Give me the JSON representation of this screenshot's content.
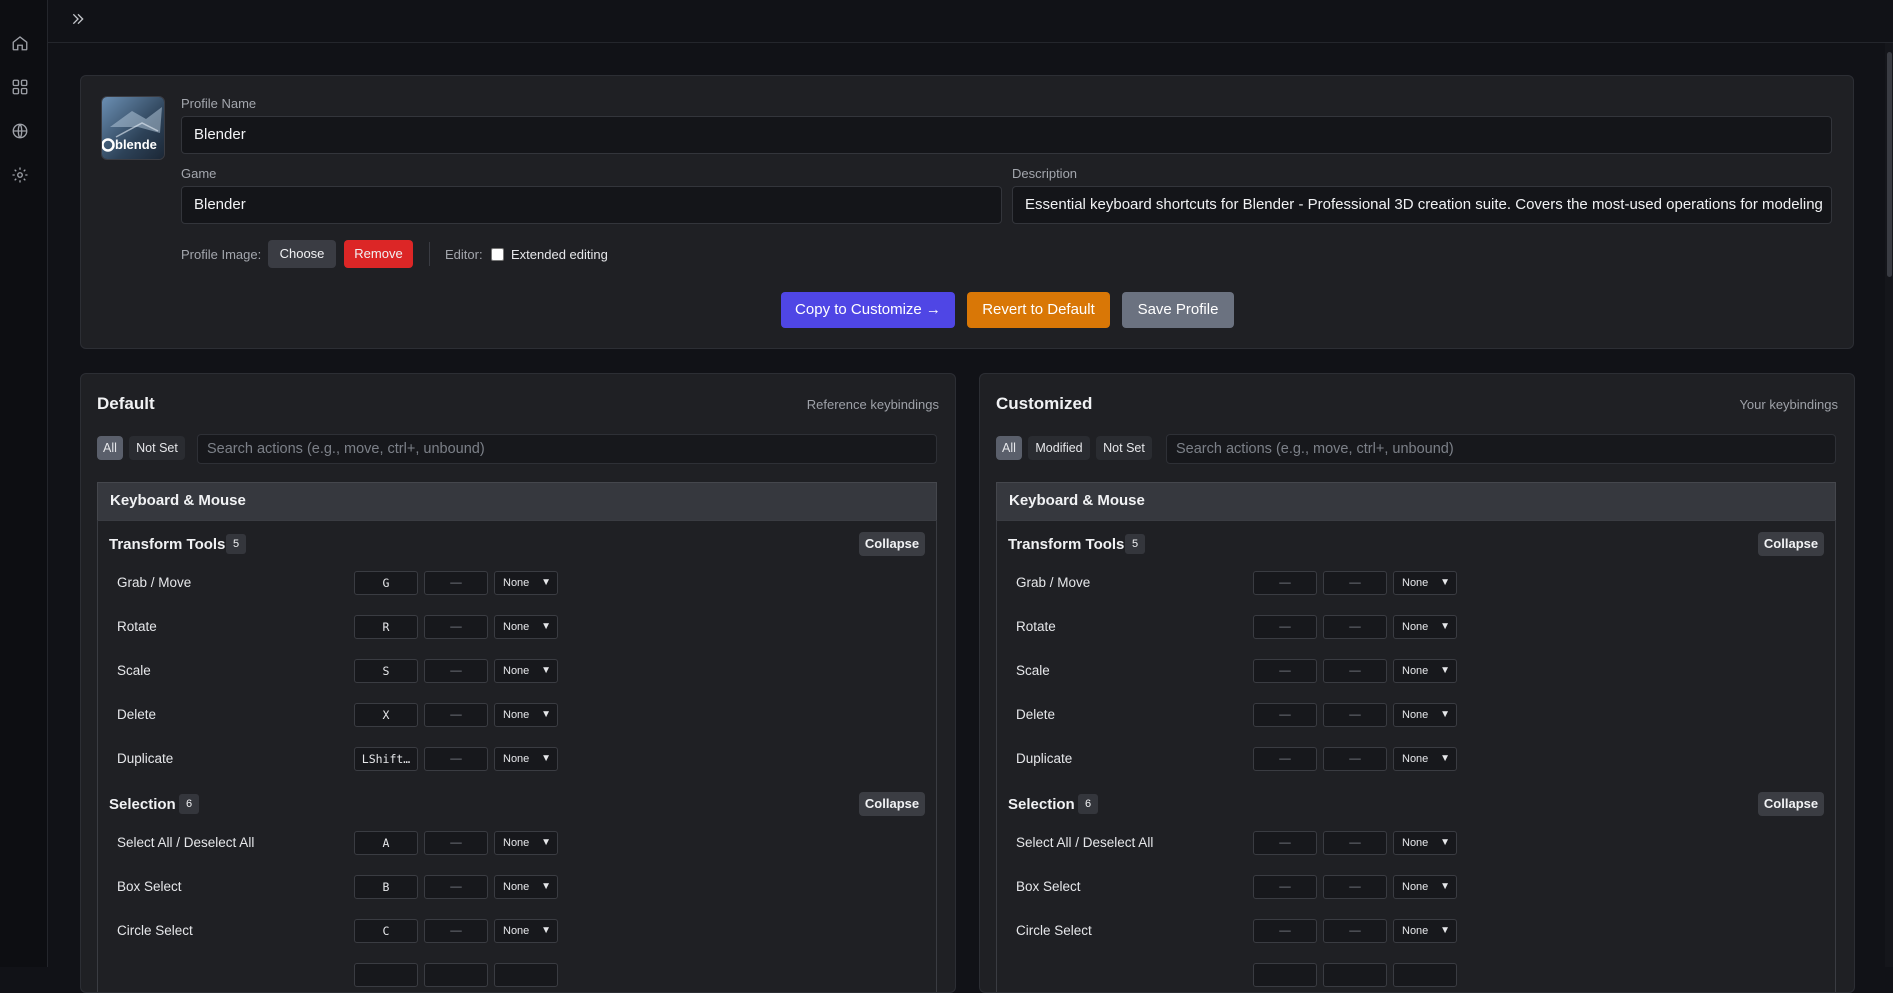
{
  "rail": {
    "icons": [
      "home-icon",
      "apps-icon",
      "globe-icon",
      "gear-icon"
    ]
  },
  "topbar": {
    "expand_icon": "double-chevron-right-icon"
  },
  "profile": {
    "name_label": "Profile Name",
    "name_value": "Blender",
    "game_label": "Game",
    "game_value": "Blender",
    "desc_label": "Description",
    "desc_value": "Essential keyboard shortcuts for Blender - Professional 3D creation suite. Covers the most-used operations for modeling",
    "image_label": "Profile Image:",
    "choose_label": "Choose",
    "remove_label": "Remove",
    "editor_label": "Editor:",
    "extended_label": "Extended editing",
    "avatar_text": "blende",
    "copy_label": "Copy to Customize →",
    "revert_label": "Revert to Default",
    "save_label": "Save Profile"
  },
  "default_panel": {
    "title": "Default",
    "subtitle": "Reference keybindings",
    "filters": [
      "All",
      "Not Set"
    ],
    "search_placeholder": "Search actions (e.g., move, ctrl+, unbound)",
    "category": "Keyboard & Mouse",
    "collapse_label": "Collapse",
    "groups": [
      {
        "name": "Transform Tools",
        "count": "5",
        "actions": [
          {
            "name": "Grab / Move",
            "key1": "G",
            "key2": "—",
            "mod": "None"
          },
          {
            "name": "Rotate",
            "key1": "R",
            "key2": "—",
            "mod": "None"
          },
          {
            "name": "Scale",
            "key1": "S",
            "key2": "—",
            "mod": "None"
          },
          {
            "name": "Delete",
            "key1": "X",
            "key2": "—",
            "mod": "None"
          },
          {
            "name": "Duplicate",
            "key1": "LShift…",
            "key2": "—",
            "mod": "None"
          }
        ]
      },
      {
        "name": "Selection",
        "count": "6",
        "actions": [
          {
            "name": "Select All / Deselect All",
            "key1": "A",
            "key2": "—",
            "mod": "None"
          },
          {
            "name": "Box Select",
            "key1": "B",
            "key2": "—",
            "mod": "None"
          },
          {
            "name": "Circle Select",
            "key1": "C",
            "key2": "—",
            "mod": "None"
          }
        ]
      }
    ]
  },
  "custom_panel": {
    "title": "Customized",
    "subtitle": "Your keybindings",
    "filters": [
      "All",
      "Modified",
      "Not Set"
    ],
    "search_placeholder": "Search actions (e.g., move, ctrl+, unbound)",
    "category": "Keyboard & Mouse",
    "collapse_label": "Collapse",
    "groups": [
      {
        "name": "Transform Tools",
        "count": "5",
        "actions": [
          {
            "name": "Grab / Move",
            "key1": "—",
            "key2": "—",
            "mod": "None"
          },
          {
            "name": "Rotate",
            "key1": "—",
            "key2": "—",
            "mod": "None"
          },
          {
            "name": "Scale",
            "key1": "—",
            "key2": "—",
            "mod": "None"
          },
          {
            "name": "Delete",
            "key1": "—",
            "key2": "—",
            "mod": "None"
          },
          {
            "name": "Duplicate",
            "key1": "—",
            "key2": "—",
            "mod": "None"
          }
        ]
      },
      {
        "name": "Selection",
        "count": "6",
        "actions": [
          {
            "name": "Select All / Deselect All",
            "key1": "—",
            "key2": "—",
            "mod": "None"
          },
          {
            "name": "Box Select",
            "key1": "—",
            "key2": "—",
            "mod": "None"
          },
          {
            "name": "Circle Select",
            "key1": "—",
            "key2": "—",
            "mod": "None"
          }
        ]
      }
    ]
  },
  "colors": {
    "accent": "#4f46e5",
    "danger": "#dc2626",
    "warning": "#d97706",
    "neutral": "#6b7280"
  }
}
